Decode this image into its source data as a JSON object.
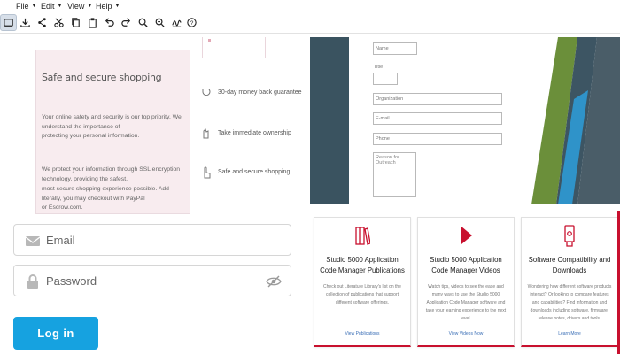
{
  "menu": [
    {
      "label": "File"
    },
    {
      "label": "Edit"
    },
    {
      "label": "View"
    },
    {
      "label": "Help"
    }
  ],
  "toolbar": {
    "tools": [
      "crop-icon",
      "download-icon",
      "share-icon",
      "cut-icon",
      "copy-icon",
      "paste-icon",
      "undo-icon",
      "redo-icon",
      "zoom-in-icon",
      "zoom-out-icon",
      "signature-icon",
      "help-icon"
    ]
  },
  "left": {
    "card_title": "Safe and secure shopping",
    "card_p1_line1": "Your online safety and security is our top priority. We understand the importance of",
    "card_p1_line2": "protecting your personal information.",
    "card_p2_line1": "We protect your information through SSL encryption technology, providing the safest,",
    "card_p2_line2": "most secure shopping experience possible. Add literally, you may checkout with PayPal",
    "card_p2_line3": "or Escrow.com.",
    "features": [
      {
        "label": "30-day money back guarantee"
      },
      {
        "label": "Take immediate ownership"
      },
      {
        "label": "Safe and secure shopping"
      }
    ],
    "email_placeholder": "Email",
    "password_placeholder": "Password",
    "login_label": "Log in"
  },
  "right": {
    "form": {
      "name": "Name",
      "title": "Title",
      "organization": "Organization",
      "email": "E-mail",
      "phone": "Phone",
      "reason": "Reason for Outreach"
    },
    "cards": [
      {
        "title": "Studio 5000 Application Code Manager Publications",
        "desc": "Check out Literature Library's list on the collection of publications that support different software offerings.",
        "link": "View Publications"
      },
      {
        "title": "Studio 5000 Application Code Manager Videos",
        "desc": "Watch tips, videos to see the ease and many ways to use the Studio 5000 Application Code Manager software and take your learning experience to the next level.",
        "link": "View Videos Now"
      },
      {
        "title": "Software Compatibility and Downloads",
        "desc": "Wondering how different software products interact? Or looking to compare features and capabilities? Find information and downloads including software, firmware, release notes, drivers and tools.",
        "link": "Learn More"
      }
    ]
  },
  "colors": {
    "accent_red": "#c8102e",
    "login_blue": "#16a2e0",
    "slate": "#3a5360",
    "green": "#6b8f3a",
    "blue": "#2f93c9"
  }
}
